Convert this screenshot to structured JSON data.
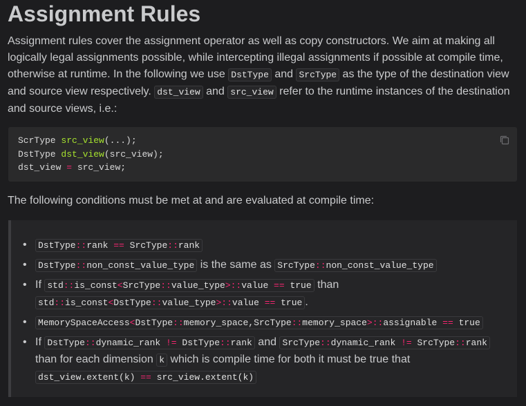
{
  "heading": "Assignment Rules",
  "intro": {
    "t1": "Assignment rules cover the assignment operator as well as copy constructors. We aim at making all logically legal assignments possible, while intercepting illegal assignments if possible at compile time, otherwise at runtime. In the following we use ",
    "c1": "DstType",
    "t2": " and ",
    "c2": "SrcType",
    "t3": " as the type of the destination view and source view respectively. ",
    "c3": "dst_view",
    "t4": " and ",
    "c4": "src_view",
    "t5": " refer to the runtime instances of the destination and source views, i.e.:"
  },
  "code": {
    "l1_type": "ScrType ",
    "l1_fn": "src_view",
    "l1_rest": "(...);",
    "l2_type": "DstType ",
    "l2_fn": "dst_view",
    "l2_rest": "(src_view);",
    "l3_a": "dst_view ",
    "l3_op": "=",
    "l3_b": " src_view;",
    "copy_icon": "copy-icon"
  },
  "conditions_lead": "The following conditions must be met at and are evaluated at compile time:",
  "conditions": {
    "i1": {
      "a": "DstType",
      "b": "::",
      "c": "rank ",
      "d": "==",
      "e": " SrcType",
      "f": "::",
      "g": "rank"
    },
    "i2": {
      "a": "DstType",
      "b": "::",
      "c": "non_const_value_type",
      "t": " is the same as ",
      "d": "SrcType",
      "e": "::",
      "f": "non_const_value_type"
    },
    "i3": {
      "t1": "If ",
      "a": "std",
      "b": "::",
      "c": "is_const",
      "d": "<",
      "e": "SrcType",
      "f": "::",
      "g": "value_type",
      "h": ">::",
      "i": "value ",
      "j": "==",
      "k": " true",
      "t2": " than ",
      "m": "std",
      "n": "::",
      "o": "is_const",
      "p": "<",
      "q": "DstType",
      "r": "::",
      "s": "value_type",
      "u": ">::",
      "v": "value ",
      "w": "==",
      "x": " true",
      "t3": "."
    },
    "i4": {
      "a": "MemorySpaceAccess",
      "b": "<",
      "c": "DstType",
      "d": "::",
      "e": "memory_space,SrcType",
      "f": "::",
      "g": "memory_space",
      "h": ">::",
      "i": "assignable ",
      "j": "==",
      "k": " true"
    },
    "i5": {
      "t1": "If ",
      "a": "DstType",
      "b": "::",
      "c": "dynamic_rank ",
      "d": "!=",
      "e": " DstType",
      "f": "::",
      "g": "rank",
      "t2": " and ",
      "h": "SrcType",
      "i": "::",
      "j": "dynamic_rank ",
      "k": "!=",
      "m": " SrcType",
      "n": "::",
      "o": "rank",
      "t3": " than for each dimension ",
      "p": "k",
      "t4": " which is compile time for both it must be true that ",
      "q": "dst_view.extent(k) ",
      "r": "==",
      "s": " src_view.extent(k)"
    }
  },
  "colors": {
    "background": "#1d1d1f",
    "text": "#c9cacc",
    "code_function": "#a6e22e",
    "code_operator": "#f92672"
  }
}
